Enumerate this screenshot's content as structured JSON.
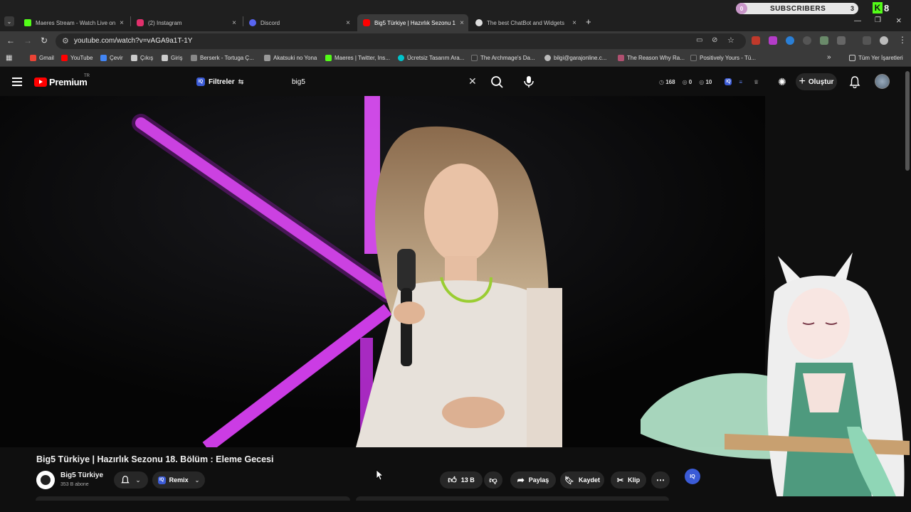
{
  "browser": {
    "tabs": [
      {
        "title": "Maeres Stream - Watch Live on",
        "color": "#53fc18"
      },
      {
        "title": "(2) Instagram",
        "color": "#e1306c"
      },
      {
        "title": "Discord",
        "color": "#5865f2"
      },
      {
        "title": "Big5 Türkiye | Hazırlık Sezonu 1",
        "color": "#ff0000"
      },
      {
        "title": "The best ChatBot and Widgets",
        "color": "#dddddd"
      }
    ],
    "new_tab": "+",
    "url": "youtube.com/watch?v=vAGA9a1T-1Y",
    "bookmarks": [
      {
        "label": "Gmail",
        "color": "#ea4335"
      },
      {
        "label": "YouTube",
        "color": "#ff0000"
      },
      {
        "label": "Çevir",
        "color": "#4285f4"
      },
      {
        "label": "Çıkış",
        "color": "#cccccc"
      },
      {
        "label": "Giriş",
        "color": "#cccccc"
      },
      {
        "label": "Berserk - Tortuga Ç...",
        "color": "#888888"
      },
      {
        "label": "Akatsuki no Yona",
        "color": "#999999"
      },
      {
        "label": "Maeres | Twitter, Ins...",
        "color": "#53fc18"
      },
      {
        "label": "Ücretsiz Tasarım Ara...",
        "color": "#00c4cc"
      },
      {
        "label": "The Archmage's Da...",
        "color": "#333333"
      },
      {
        "label": "bilgi@garajonline.c...",
        "color": "#bbbbbb"
      },
      {
        "label": "The Reason Why Ra...",
        "color": "#b05070"
      },
      {
        "label": "Positively Yours - Tü...",
        "color": "#333333"
      }
    ],
    "bookmarks_more": "»",
    "all_bookmarks": "Tüm Yer İşaretleri"
  },
  "overlay": {
    "subs_count": "0",
    "subs_label": "SUBSCRIBERS",
    "subs_goal": "3",
    "kick_count": "8"
  },
  "youtube": {
    "logo_text": "Premium",
    "country": "TR",
    "filters_label": "Filtreler",
    "search_value": "big5",
    "ext_stats": {
      "views": "168",
      "likes": "0",
      "comments": "10"
    },
    "create_label": "Oluştur",
    "video_title": "Big5 Türkiye | Hazırlık Sezonu 18. Bölüm : Eleme Gecesi",
    "channel_name": "Big5 Türkiye",
    "channel_subs": "353 B abone",
    "remix_label": "Remix",
    "like_count": "13 B",
    "share_label": "Paylaş",
    "save_label": "Kaydet",
    "clip_label": "Klip",
    "iq_label": "IQ"
  },
  "colors": {
    "brand_red": "#ff0000",
    "neon": "#d43cf0",
    "pill_bg": "#272727"
  }
}
